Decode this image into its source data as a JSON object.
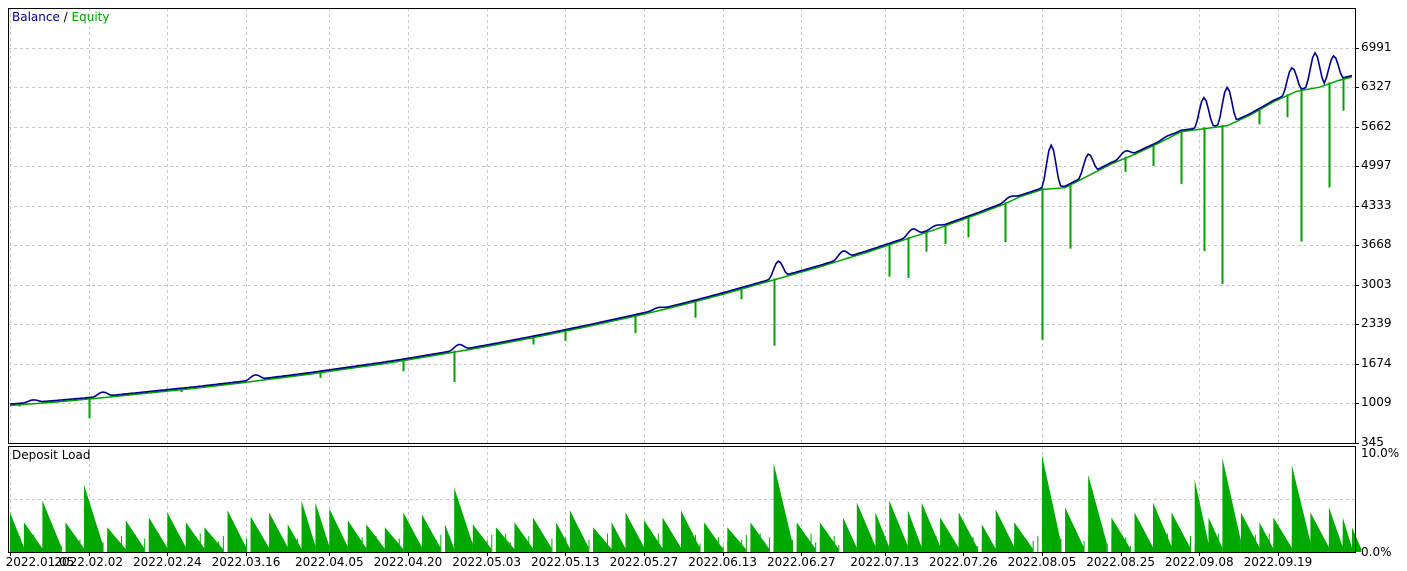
{
  "colors": {
    "balance": "#00008b",
    "equity": "#00a000",
    "deposit_load": "#00a800",
    "grid": "#c8c8c8",
    "frame": "#000000",
    "background": "#ffffff"
  },
  "chart_data": [
    {
      "type": "line",
      "title": "",
      "legend": {
        "balance_label": "Balance",
        "separator": " / ",
        "equity_label": "Equity",
        "placement": "top-left"
      },
      "y_ticks": [
        345,
        1009,
        1674,
        2339,
        3003,
        3668,
        4333,
        4997,
        5662,
        6327,
        6991
      ],
      "ylim": [
        345,
        7655
      ],
      "grid": true,
      "balance": [
        [
          0,
          1000
        ],
        [
          5,
          1030
        ],
        [
          10,
          1060
        ],
        [
          15,
          1095
        ],
        [
          20,
          1130
        ],
        [
          25,
          1170
        ],
        [
          30,
          1210
        ],
        [
          35,
          1250
        ],
        [
          40,
          1290
        ],
        [
          45,
          1335
        ],
        [
          50,
          1380
        ],
        [
          55,
          1430
        ],
        [
          60,
          1480
        ],
        [
          65,
          1530
        ],
        [
          70,
          1585
        ],
        [
          75,
          1640
        ],
        [
          80,
          1695
        ],
        [
          85,
          1755
        ],
        [
          90,
          1820
        ],
        [
          95,
          1885
        ],
        [
          100,
          1950
        ],
        [
          105,
          2020
        ],
        [
          110,
          2095
        ],
        [
          115,
          2170
        ],
        [
          120,
          2250
        ],
        [
          125,
          2330
        ],
        [
          130,
          2415
        ],
        [
          135,
          2500
        ],
        [
          140,
          2590
        ],
        [
          145,
          2685
        ],
        [
          150,
          2785
        ],
        [
          155,
          2890
        ],
        [
          160,
          3000
        ],
        [
          165,
          3110
        ],
        [
          170,
          3220
        ],
        [
          175,
          3330
        ],
        [
          180,
          3450
        ],
        [
          185,
          3570
        ],
        [
          190,
          3700
        ],
        [
          195,
          3830
        ],
        [
          200,
          3960
        ],
        [
          205,
          4100
        ],
        [
          210,
          4240
        ],
        [
          215,
          4390
        ],
        [
          218,
          4500
        ],
        [
          223,
          4630
        ],
        [
          228,
          4660
        ],
        [
          233,
          4860
        ],
        [
          238,
          5060
        ],
        [
          243,
          5220
        ],
        [
          248,
          5400
        ],
        [
          253,
          5600
        ],
        [
          258,
          5650
        ],
        [
          263,
          5700
        ],
        [
          268,
          5880
        ],
        [
          273,
          6100
        ],
        [
          278,
          6280
        ],
        [
          283,
          6350
        ],
        [
          287,
          6460
        ],
        [
          290,
          6520
        ]
      ],
      "equity_spikes_up": [
        [
          5,
          1070
        ],
        [
          20,
          1200
        ],
        [
          53,
          1490
        ],
        [
          97,
          2000
        ],
        [
          140,
          2620
        ],
        [
          166,
          3400
        ],
        [
          180,
          3570
        ],
        [
          195,
          3940
        ],
        [
          200,
          4000
        ],
        [
          216,
          4480
        ],
        [
          225,
          5350
        ],
        [
          233,
          5200
        ],
        [
          241,
          5250
        ],
        [
          250,
          5500
        ],
        [
          258,
          6150
        ],
        [
          263,
          6320
        ],
        [
          277,
          6650
        ],
        [
          282,
          6900
        ],
        [
          286,
          6850
        ]
      ],
      "equity_spikes_down": [
        [
          2,
          960
        ],
        [
          17,
          760
        ],
        [
          37,
          1200
        ],
        [
          52,
          1400
        ],
        [
          60,
          1470
        ],
        [
          67,
          1440
        ],
        [
          85,
          1550
        ],
        [
          96,
          1370
        ],
        [
          113,
          2000
        ],
        [
          120,
          2060
        ],
        [
          135,
          2190
        ],
        [
          148,
          2450
        ],
        [
          158,
          2760
        ],
        [
          165,
          1980
        ],
        [
          181,
          3450
        ],
        [
          190,
          3140
        ],
        [
          194,
          3120
        ],
        [
          198,
          3560
        ],
        [
          202,
          3690
        ],
        [
          207,
          3800
        ],
        [
          215,
          3720
        ],
        [
          223,
          2080
        ],
        [
          229,
          3610
        ],
        [
          241,
          4900
        ],
        [
          247,
          5000
        ],
        [
          253,
          4700
        ],
        [
          258,
          3570
        ],
        [
          262,
          3020
        ],
        [
          270,
          5700
        ],
        [
          276,
          5820
        ],
        [
          279,
          3730
        ],
        [
          285,
          4640
        ],
        [
          288,
          5930
        ]
      ],
      "x_ticks": [
        {
          "label": "2022.01.05",
          "t": 0
        },
        {
          "label": "2022.02.02",
          "t": 17
        },
        {
          "label": "2022.02.24",
          "t": 34
        },
        {
          "label": "2022.03.16",
          "t": 51
        },
        {
          "label": "2022.04.05",
          "t": 69
        },
        {
          "label": "2022.04.20",
          "t": 86
        },
        {
          "label": "2022.05.03",
          "t": 103
        },
        {
          "label": "2022.05.13",
          "t": 120
        },
        {
          "label": "2022.05.27",
          "t": 137
        },
        {
          "label": "2022.06.13",
          "t": 154
        },
        {
          "label": "2022.06.27",
          "t": 171
        },
        {
          "label": "2022.07.13",
          "t": 189
        },
        {
          "label": "2022.07.26",
          "t": 206
        },
        {
          "label": "2022.08.05",
          "t": 223
        },
        {
          "label": "2022.08.25",
          "t": 240
        },
        {
          "label": "2022.09.08",
          "t": 257
        },
        {
          "label": "2022.09.19",
          "t": 274
        }
      ],
      "xlim": [
        0,
        290
      ]
    },
    {
      "type": "bar",
      "title": "Deposit Load",
      "y_ticks": [
        "10.0%",
        "0.0%"
      ],
      "ylim": [
        0,
        10
      ],
      "grid": true,
      "peaks": [
        [
          0,
          4.0
        ],
        [
          3,
          3.0
        ],
        [
          7,
          5.2
        ],
        [
          12,
          3.0
        ],
        [
          16,
          6.8
        ],
        [
          21,
          2.5
        ],
        [
          25,
          3.2
        ],
        [
          30,
          3.5
        ],
        [
          34,
          4.0
        ],
        [
          38,
          3.0
        ],
        [
          42,
          2.5
        ],
        [
          47,
          4.2
        ],
        [
          52,
          3.6
        ],
        [
          56,
          4.0
        ],
        [
          60,
          2.8
        ],
        [
          63,
          5.2
        ],
        [
          66,
          5.0
        ],
        [
          69,
          4.4
        ],
        [
          73,
          3.2
        ],
        [
          77,
          2.8
        ],
        [
          81,
          2.5
        ],
        [
          85,
          4.0
        ],
        [
          89,
          3.8
        ],
        [
          94,
          2.8
        ],
        [
          96,
          6.5
        ],
        [
          100,
          2.8
        ],
        [
          105,
          2.5
        ],
        [
          109,
          3.0
        ],
        [
          113,
          3.5
        ],
        [
          118,
          3.0
        ],
        [
          121,
          4.2
        ],
        [
          126,
          2.5
        ],
        [
          130,
          3.0
        ],
        [
          133,
          4.0
        ],
        [
          137,
          3.2
        ],
        [
          141,
          3.5
        ],
        [
          145,
          4.2
        ],
        [
          150,
          3.0
        ],
        [
          155,
          2.5
        ],
        [
          160,
          3.0
        ],
        [
          165,
          9.0
        ],
        [
          170,
          3.0
        ],
        [
          175,
          3.0
        ],
        [
          180,
          3.5
        ],
        [
          183,
          5.0
        ],
        [
          187,
          4.0
        ],
        [
          190,
          5.2
        ],
        [
          194,
          4.2
        ],
        [
          197,
          5.0
        ],
        [
          201,
          3.5
        ],
        [
          205,
          4.0
        ],
        [
          210,
          2.8
        ],
        [
          213,
          4.3
        ],
        [
          217,
          3.0
        ],
        [
          223,
          9.8
        ],
        [
          228,
          4.5
        ],
        [
          233,
          7.8
        ],
        [
          238,
          3.5
        ],
        [
          243,
          4.0
        ],
        [
          247,
          5.0
        ],
        [
          251,
          4.0
        ],
        [
          256,
          7.3
        ],
        [
          259,
          3.5
        ],
        [
          262,
          9.5
        ],
        [
          266,
          4.0
        ],
        [
          270,
          3.0
        ],
        [
          273,
          3.5
        ],
        [
          277,
          8.8
        ],
        [
          281,
          4.0
        ],
        [
          285,
          4.5
        ],
        [
          288,
          3.5
        ],
        [
          290,
          2.5
        ]
      ]
    }
  ]
}
